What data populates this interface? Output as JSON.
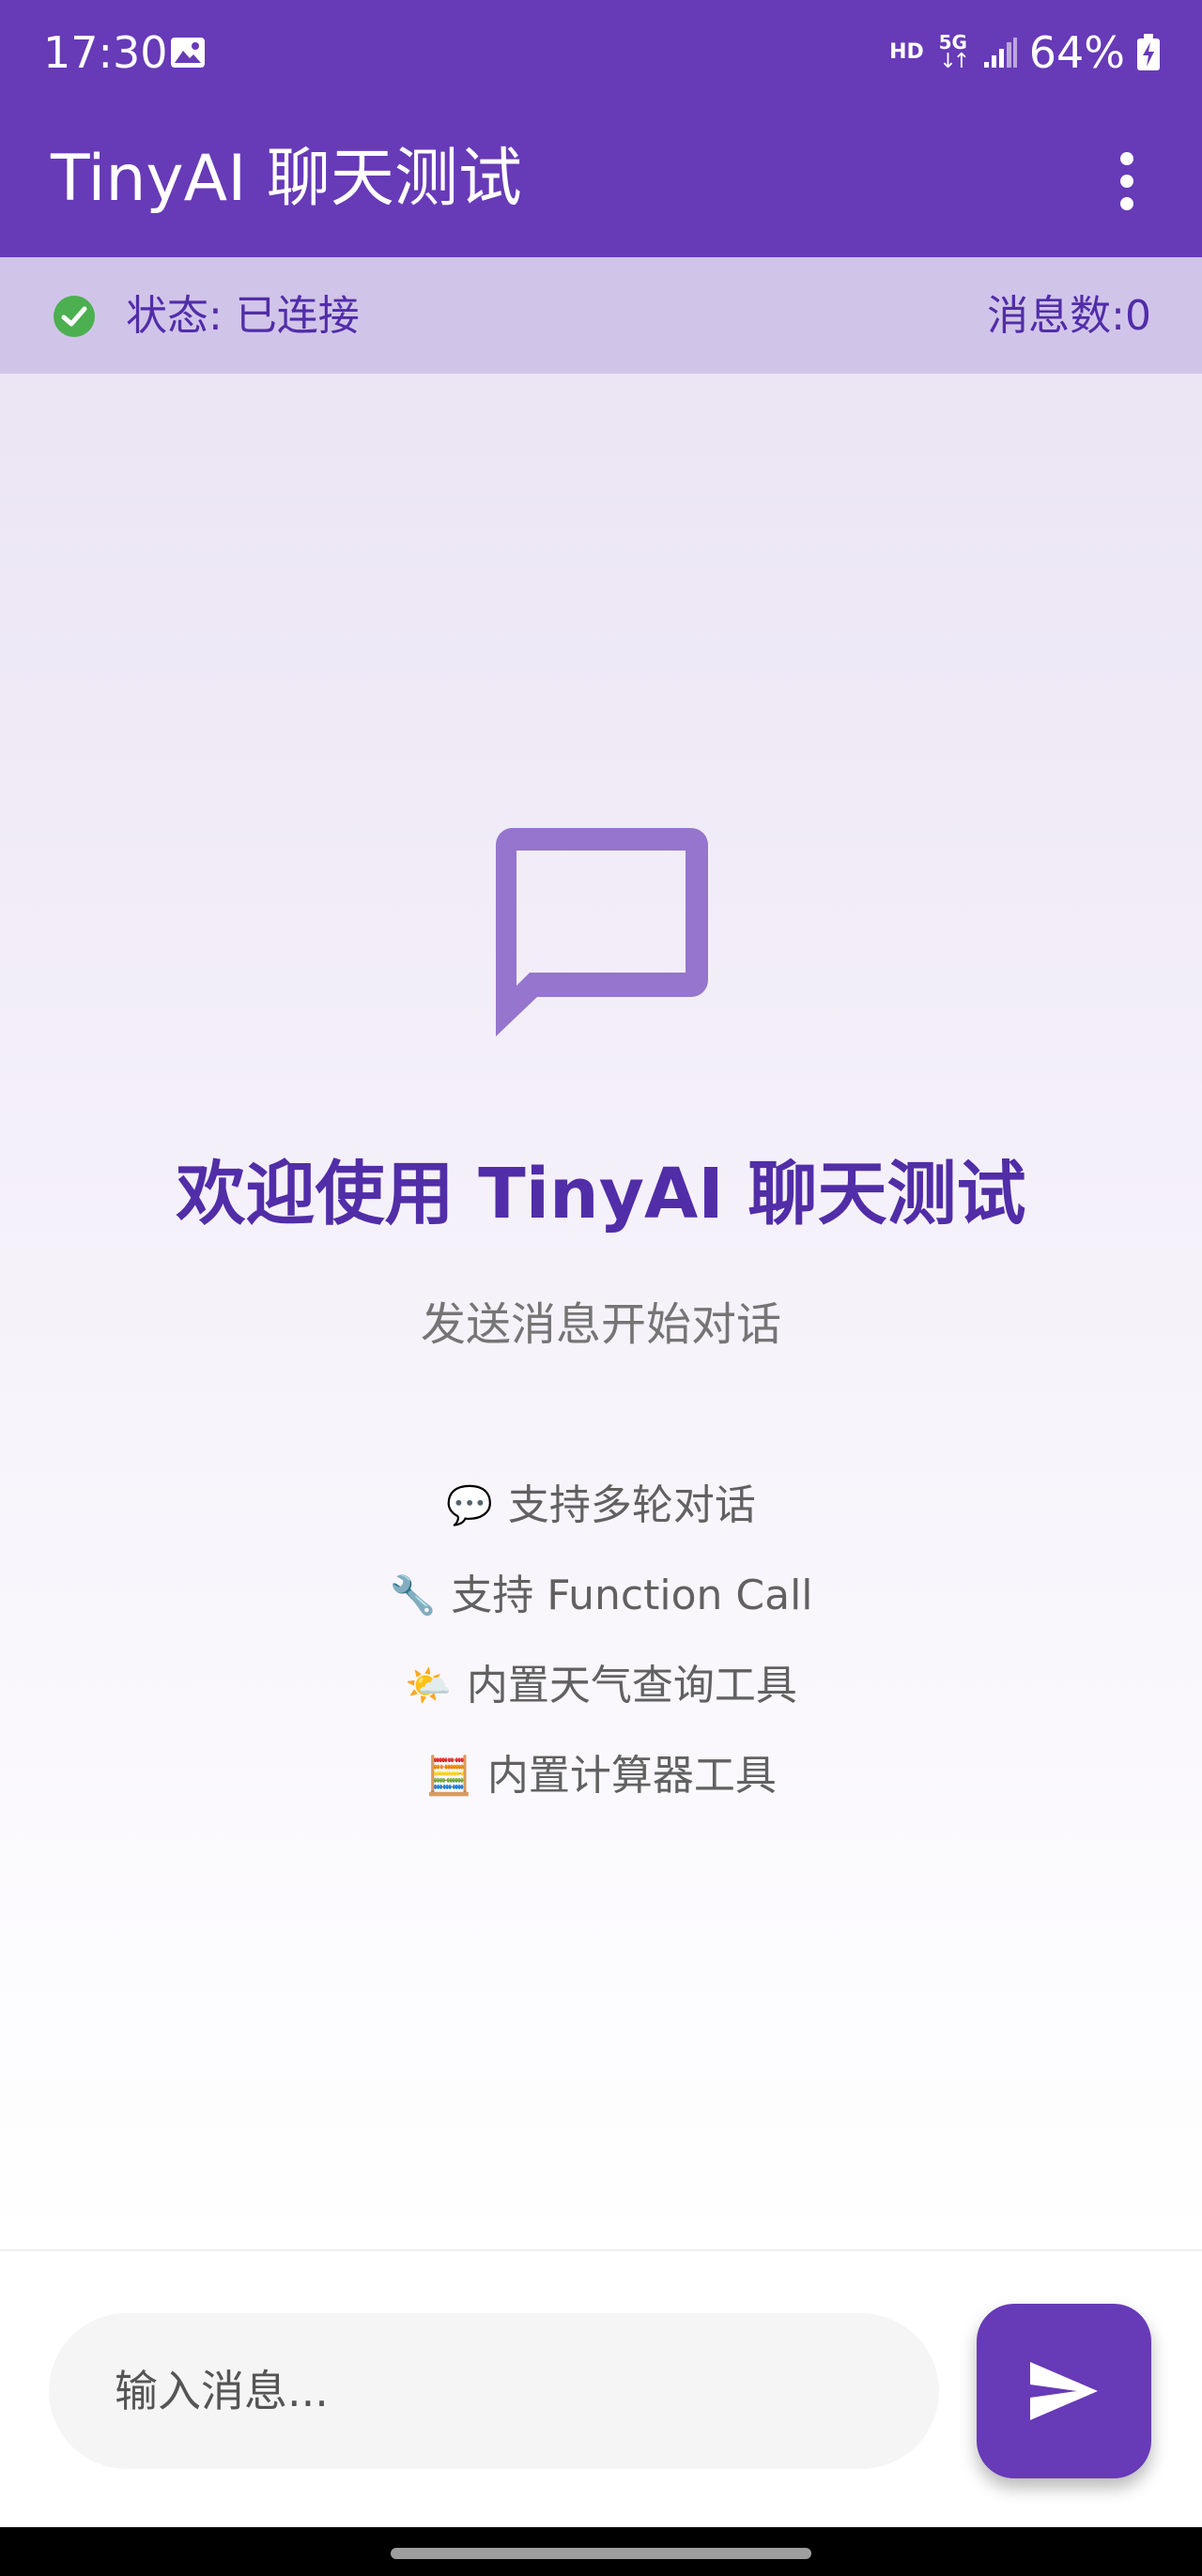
{
  "status_bar": {
    "time": "17:30",
    "hd": "HD",
    "network": "5G",
    "battery": "64%",
    "icons": [
      "image-icon",
      "network-arrows-icon",
      "signal-icon",
      "battery-charging-icon"
    ]
  },
  "app_bar": {
    "title": "TinyAI 聊天测试",
    "menu_icon": "more-vert-icon"
  },
  "connection": {
    "status_text": "状态: 已连接",
    "count_label": "消息数: ",
    "count_value": "0",
    "status_icon": "check-circle-icon",
    "status_color": "#4caf50"
  },
  "welcome": {
    "icon": "chat-bubble-icon",
    "title": "欢迎使用 TinyAI 聊天测试",
    "subtitle": "发送消息开始对话",
    "features": [
      {
        "emoji": "💬",
        "text": "支持多轮对话"
      },
      {
        "emoji": "🔧",
        "text": "支持 Function Call"
      },
      {
        "emoji": "🌤️",
        "text": "内置天气查询工具"
      },
      {
        "emoji": "🧮",
        "text": "内置计算器工具"
      }
    ]
  },
  "composer": {
    "placeholder": "输入消息...",
    "send_icon": "send-icon"
  },
  "colors": {
    "primary": "#673ab7",
    "primary_dark": "#512da8",
    "strip": "#d1c4e9",
    "icon_tint": "#9575cd"
  }
}
